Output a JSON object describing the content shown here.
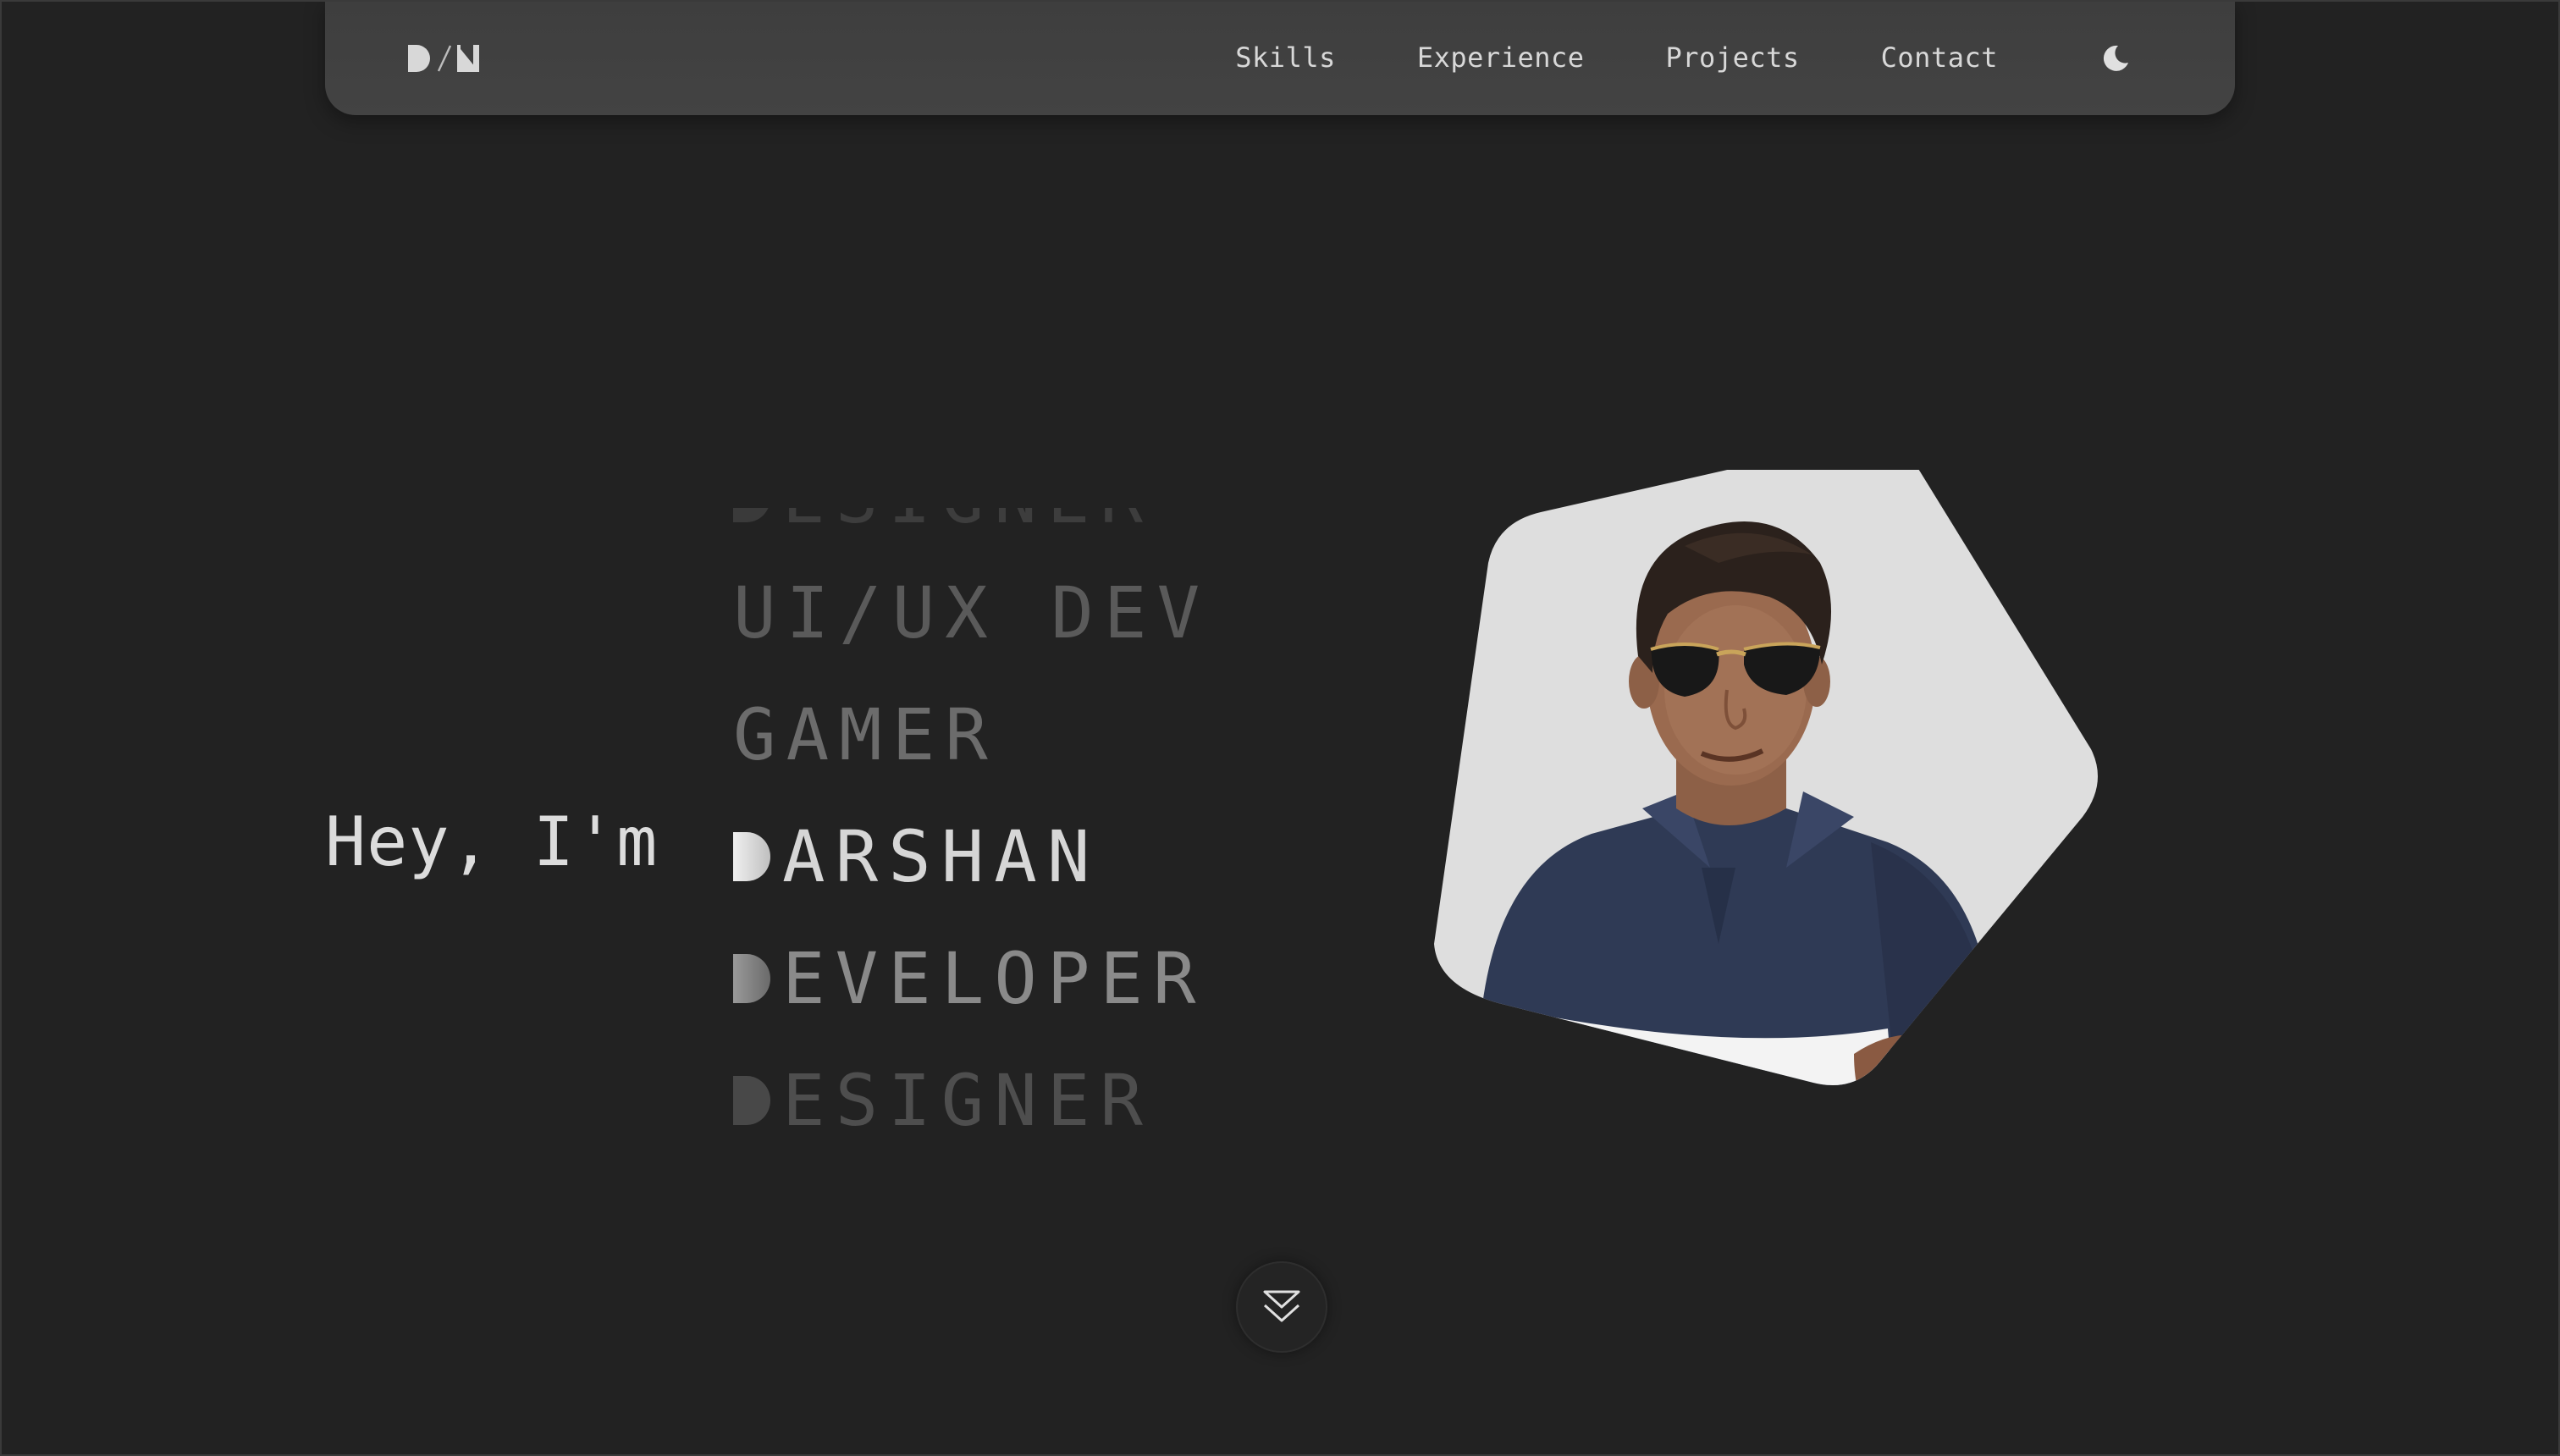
{
  "nav": {
    "logo": "D/N",
    "links": [
      "Skills",
      "Experience",
      "Projects",
      "Contact"
    ],
    "theme_icon": "moon-icon"
  },
  "hero": {
    "greeting": "Hey, I'm",
    "roles": [
      {
        "first": "D",
        "rest": "ESIGNER"
      },
      {
        "first": "",
        "rest": "UI/UX DEV"
      },
      {
        "first": "G",
        "rest": "AMER"
      },
      {
        "first": "D",
        "rest": "ARSHAN"
      },
      {
        "first": "D",
        "rest": "EVELOPER"
      },
      {
        "first": "D",
        "rest": "ESIGNER"
      }
    ],
    "active_role_index": 3,
    "scroll_icon": "double-chevron-down-icon"
  },
  "colors": {
    "background": "#222222",
    "navbar": "#404040",
    "text": "#dcdcdc",
    "portrait_bg": "#dedede"
  }
}
